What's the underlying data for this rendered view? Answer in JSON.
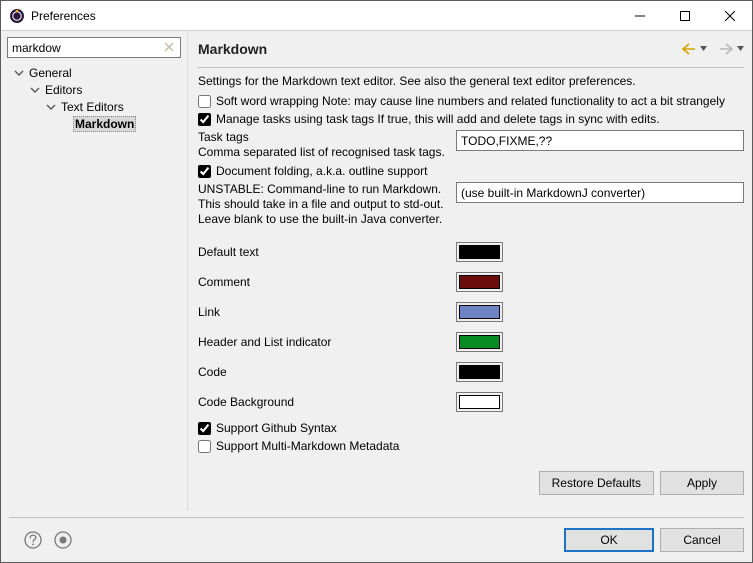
{
  "window": {
    "title": "Preferences"
  },
  "sidebar": {
    "filter_value": "markdow",
    "items": [
      {
        "label": "General",
        "depth": 1,
        "expanded": true
      },
      {
        "label": "Editors",
        "depth": 2,
        "expanded": true
      },
      {
        "label": "Text Editors",
        "depth": 3,
        "expanded": true
      },
      {
        "label": "Markdown",
        "depth": 4,
        "expanded": false,
        "selected": true
      }
    ]
  },
  "page": {
    "title": "Markdown",
    "description": "Settings for the Markdown text editor. See also the general text editor preferences.",
    "soft_wrap": {
      "checked": false,
      "label": "Soft word wrapping Note: may cause line numbers and related functionality to act a bit strangely"
    },
    "manage_tasks": {
      "checked": true,
      "label": "Manage tasks using task tags If true, this will add and delete tags in sync with edits."
    },
    "task_tags_label": "Task tags\nComma separated list of recognised task tags.",
    "task_tags_value": "TODO,FIXME,??",
    "folding": {
      "checked": true,
      "label": "Document folding, a.k.a. outline support"
    },
    "cmdline_label": "UNSTABLE: Command-line to run Markdown.\nThis should take in a file and output to std-out.\nLeave blank to use the built-in Java converter.",
    "cmdline_value": "(use built-in MarkdownJ converter)",
    "colors": [
      {
        "label": "Default text",
        "hex": "#000000"
      },
      {
        "label": "Comment",
        "hex": "#6b0d0d"
      },
      {
        "label": "Link",
        "hex": "#6e84c4"
      },
      {
        "label": "Header and List indicator",
        "hex": "#068c22"
      },
      {
        "label": "Code",
        "hex": "#000000"
      },
      {
        "label": "Code Background",
        "hex": "#ffffff"
      }
    ],
    "github_syntax": {
      "checked": true,
      "label": "Support Github Syntax"
    },
    "multi_md": {
      "checked": false,
      "label": "Support Multi-Markdown Metadata"
    },
    "restore_defaults": "Restore Defaults",
    "apply": "Apply"
  },
  "footer": {
    "ok": "OK",
    "cancel": "Cancel"
  }
}
